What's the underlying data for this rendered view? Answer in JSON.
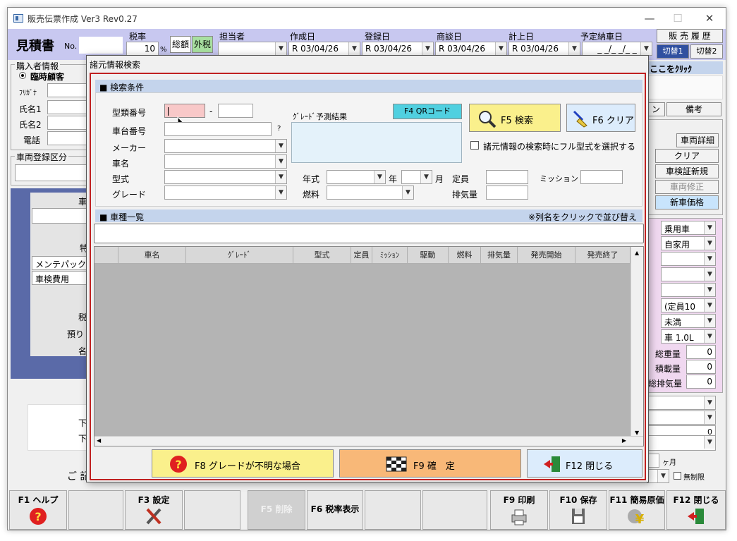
{
  "window": {
    "title": "販売伝票作成 Ver3 Rev0.27",
    "minimize": "—",
    "maximize": "☐",
    "close": "✕"
  },
  "header": {
    "doc_title": "見積書",
    "no_label": "No.",
    "tax_rate_label": "税率",
    "tax_rate_value": "10",
    "tax_rate_unit": "%",
    "tax_mode": [
      "総額",
      "外税"
    ],
    "staff_label": "担当者",
    "created_label": "作成日",
    "created_value": "R 03/04/26",
    "registered_label": "登録日",
    "registered_value": "R 03/04/26",
    "negotiated_label": "商談日",
    "negotiated_value": "R 03/04/26",
    "recorded_label": "計上日",
    "recorded_value": "R 03/04/26",
    "delivery_label": "予定納車日",
    "delivery_value": "_ _/_ _/_ _",
    "history_button": "販 売 履 歴",
    "switch1": "切替1",
    "switch2": "切替2"
  },
  "left": {
    "buyer_group": "購入者情報",
    "radio_temp": "臨時顧客",
    "furigana": "ﾌﾘｶﾞﾅ",
    "name1": "氏名1",
    "name2": "氏名2",
    "phone": "電話",
    "reg_group": "車両登録区分",
    "maint_pack": "メンテパック",
    "inspection_fee": "車検費用",
    "frag1": "車",
    "frag2": "特",
    "frag3": "税",
    "frag4": "預り",
    "frag5": "名",
    "frag6": "下",
    "frag7": "下",
    "frag8": "ご 記"
  },
  "right": {
    "click_here": "ここをｸﾘｯｸ",
    "tab_n": "ン",
    "tab_notes": "備考",
    "btn_vehicle_detail": "車両詳細",
    "btn_clear": "クリア",
    "btn_inspection": "車検証新規",
    "btn_vehicle_edit": "車両修正",
    "btn_new_price": "新車価格",
    "combo_use": "乗用車",
    "combo_private": "自家用",
    "combo_capacity": "(定員10",
    "combo_under": "未満",
    "combo_engine": "車 1.0L",
    "total_weight_label": "総重量",
    "total_weight": "0",
    "load_label": "積載量",
    "load": "0",
    "displacement_label": "総排気量",
    "displacement": "0",
    "zero": "0",
    "months": "ヶ月",
    "unlimited": "無制限"
  },
  "dialog": {
    "title": "諸元情報検索",
    "search_section": "■ 検索条件",
    "type_no_label": "型類番号",
    "type_no_value": "",
    "dash": "-",
    "chassis_label": "車台番号",
    "chassis_help": "?",
    "maker_label": "メーカー",
    "car_name_label": "車名",
    "model_label": "型式",
    "grade_label": "グレード",
    "grade_pred_label": "ｸﾞﾚｰﾄﾞ予測結果",
    "qr_button": "F4 QRコード",
    "search_button": "F5 検索",
    "clear_button": "F6 クリア",
    "fullmodel_checkbox": "諸元情報の検索時にフル型式を選択する",
    "year_label": "年式",
    "year_unit": "年",
    "month_unit": "月",
    "capacity_label": "定員",
    "mission_label": "ミッション",
    "fuel_label": "燃料",
    "displacement_label": "排気量",
    "list_section": "■ 車種一覧",
    "sort_hint": "※列名をクリックで並び替え",
    "columns": [
      "車名",
      "ｸﾞﾚｰﾄﾞ",
      "型式",
      "定員",
      "ﾐｯｼｮﾝ",
      "駆動",
      "燃料",
      "排気量",
      "発売開始",
      "発売終了"
    ],
    "unknown_grade_button": "F8 グレードが不明な場合",
    "confirm_button": "F9 確　定",
    "close_button": "F12 閉じる"
  },
  "fkeys": {
    "f1": "F1 ヘルプ",
    "f3": "F3 設定",
    "f5": "F5 削除",
    "f6": "F6 税率表示",
    "f9": "F9 印刷",
    "f10": "F10 保存",
    "f11": "F11 簡易原価",
    "f12": "F12 閉じる"
  },
  "colors": {
    "header_bg": "#c8c8f0",
    "dialog_border": "#c02020",
    "section_bg": "#c4d4ec",
    "f8_bg": "#faf08c",
    "f9_bg": "#f8b878",
    "f12_bg": "#dcecfc"
  }
}
